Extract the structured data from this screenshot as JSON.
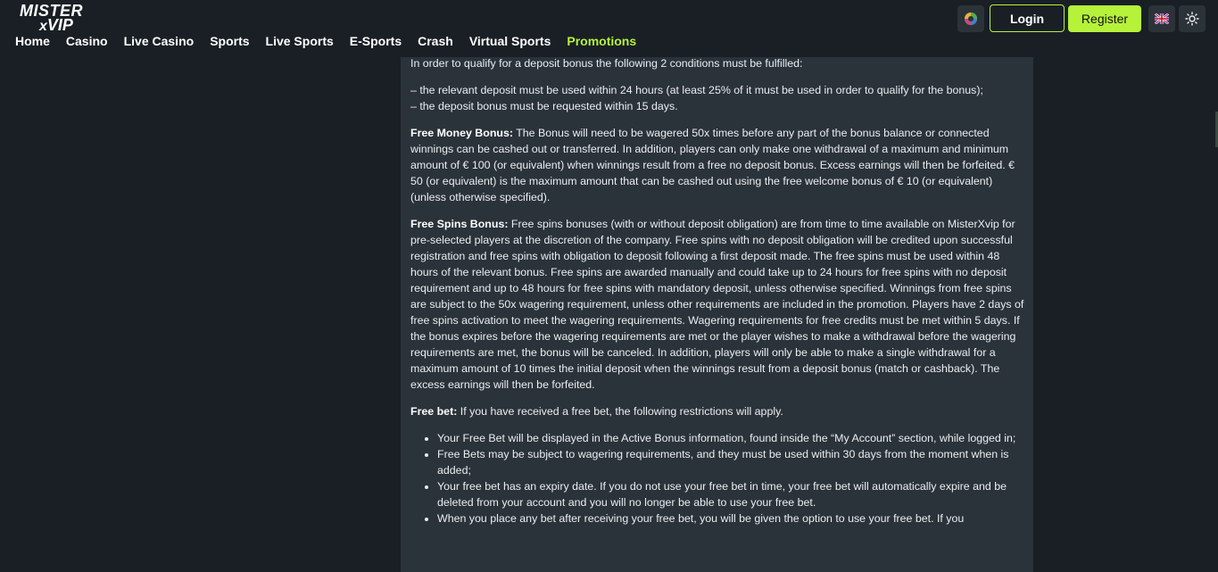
{
  "logo": {
    "line1": "MISTER",
    "line2_x": "x",
    "line2_rest": "VIP"
  },
  "nav": {
    "items": [
      {
        "label": "Home"
      },
      {
        "label": "Casino"
      },
      {
        "label": "Live Casino"
      },
      {
        "label": "Sports"
      },
      {
        "label": "Live Sports"
      },
      {
        "label": "E-Sports"
      },
      {
        "label": "Crash"
      },
      {
        "label": "Virtual Sports"
      },
      {
        "label": "Promotions",
        "active": true
      }
    ]
  },
  "header": {
    "login_label": "Login",
    "register_label": "Register",
    "icons": [
      "chip-icon",
      "uk-flag-icon",
      "sun-icon"
    ]
  },
  "colors": {
    "accent": "#b6f23a",
    "background": "#191f24",
    "panel": "#2b333a"
  },
  "content": {
    "intro": "In order to qualify for a deposit bonus the following 2 conditions must be fulfilled:",
    "cond1": "– the relevant deposit must be used within 24 hours (at least 25% of it must be used in order to qualify for the bonus);",
    "cond2": "– the deposit bonus must be requested within 15 days.",
    "free_money_title": "Free Money Bonus:",
    "free_money_text": " The Bonus will need to be wagered 50x times before any part of the bonus balance or connected winnings can be cashed out or transferred. In addition, players can only make one withdrawal of a maximum and minimum amount of € 100 (or equivalent) when winnings result from a free no deposit bonus. Excess earnings will then be forfeited. € 50 (or equivalent) is the maximum amount that can be cashed out using the free welcome bonus of € 10 (or equivalent) (unless otherwise specified).",
    "free_spins_title": "Free Spins Bonus:",
    "free_spins_text": " Free spins bonuses (with or without deposit obligation) are from time to time available on MisterXvip for pre-selected players at the discretion of the company. Free spins with no deposit obligation will be credited upon successful registration and free spins with obligation to deposit following a first deposit made. The free spins must be used within 48 hours of the relevant bonus. Free spins are awarded manually and could take up to 24 hours for free spins with no deposit requirement and up to 48 hours for free spins with mandatory deposit, unless otherwise specified. Winnings from free spins are subject to the 50x wagering requirement, unless other requirements are included in the promotion. Players have 2 days of free spins activation to meet the wagering requirements. Wagering requirements for free credits must be met within 5 days. If the bonus expires before the wagering requirements are met or the player wishes to make a withdrawal before the wagering requirements are met, the bonus will be canceled. In addition, players will only be able to make a single withdrawal for a maximum amount of 10 times the initial deposit when the winnings result from a deposit bonus (match or cashback). The excess earnings will then be forfeited.",
    "free_bet_title": "Free bet:",
    "free_bet_text": " If you have received a free bet, the following restrictions will apply.",
    "free_bet_list": [
      "Your Free Bet will be displayed in the Active Bonus information, found inside the “My Account” section, while logged in;",
      "Free Bets may be subject to wagering requirements, and they must be used within 30 days from the moment when is added;",
      "Your free bet has an expiry date. If you do not use your free bet in time, your free bet will automatically expire and be deleted from your account and you will no longer be able to use your free bet.",
      "When you place any bet after receiving your free bet, you will be given the option to use your free bet. If you"
    ]
  }
}
